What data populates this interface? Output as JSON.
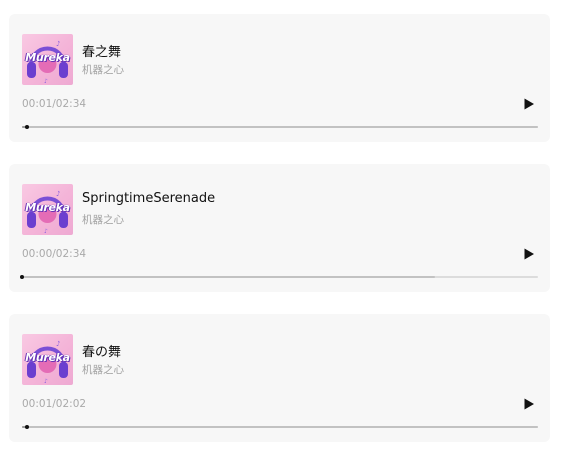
{
  "players": [
    {
      "title": "春之舞",
      "artist": "机器之心",
      "cover_text": "Mureka",
      "current_time": "00:01",
      "duration": "02:34",
      "time_label": "00:01/02:34",
      "progress": 0.01,
      "buffered": 1.0,
      "play_icon": "play-icon"
    },
    {
      "title": "SpringtimeSerenade",
      "artist": "机器之心",
      "cover_text": "Mureka",
      "current_time": "00:00",
      "duration": "02:34",
      "time_label": "00:00/02:34",
      "progress": 0.0,
      "buffered": 0.8,
      "play_icon": "play-icon"
    },
    {
      "title": "春の舞",
      "artist": "机器之心",
      "cover_text": "Mureka",
      "current_time": "00:01",
      "duration": "02:02",
      "time_label": "00:01/02:02",
      "progress": 0.01,
      "buffered": 1.0,
      "play_icon": "play-icon"
    }
  ],
  "colors": {
    "card_background": "#f7f7f7",
    "title": "#111111",
    "subtitle": "#a2a2a2",
    "cover_pink": "#f4b4d8",
    "headphones_purple": "#7a4fd6"
  }
}
